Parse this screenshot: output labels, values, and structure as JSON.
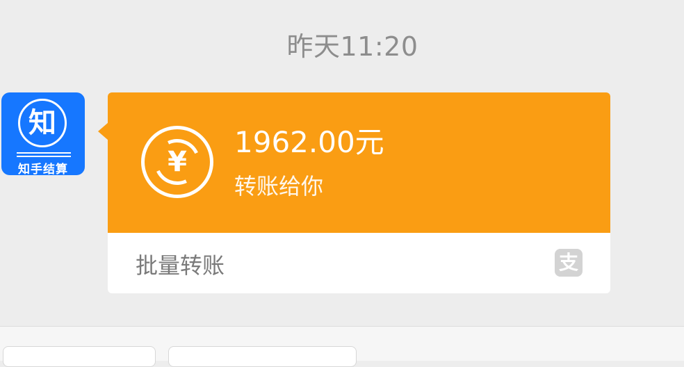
{
  "chat": {
    "timestamp": "昨天11:20"
  },
  "sender": {
    "avatar_label": "知",
    "avatar_name": "知手结算"
  },
  "transfer_card": {
    "amount": "1962.00元",
    "subtitle": "转账给你",
    "footer_label": "批量转账",
    "accent_color": "#fa9d13",
    "icon": "yen-transfer-icon",
    "footer_icon": "alipay-icon",
    "footer_icon_glyph": "支",
    "yen_glyph": "¥"
  },
  "bottom_bar": {
    "buttons": [
      "",
      ""
    ]
  }
}
